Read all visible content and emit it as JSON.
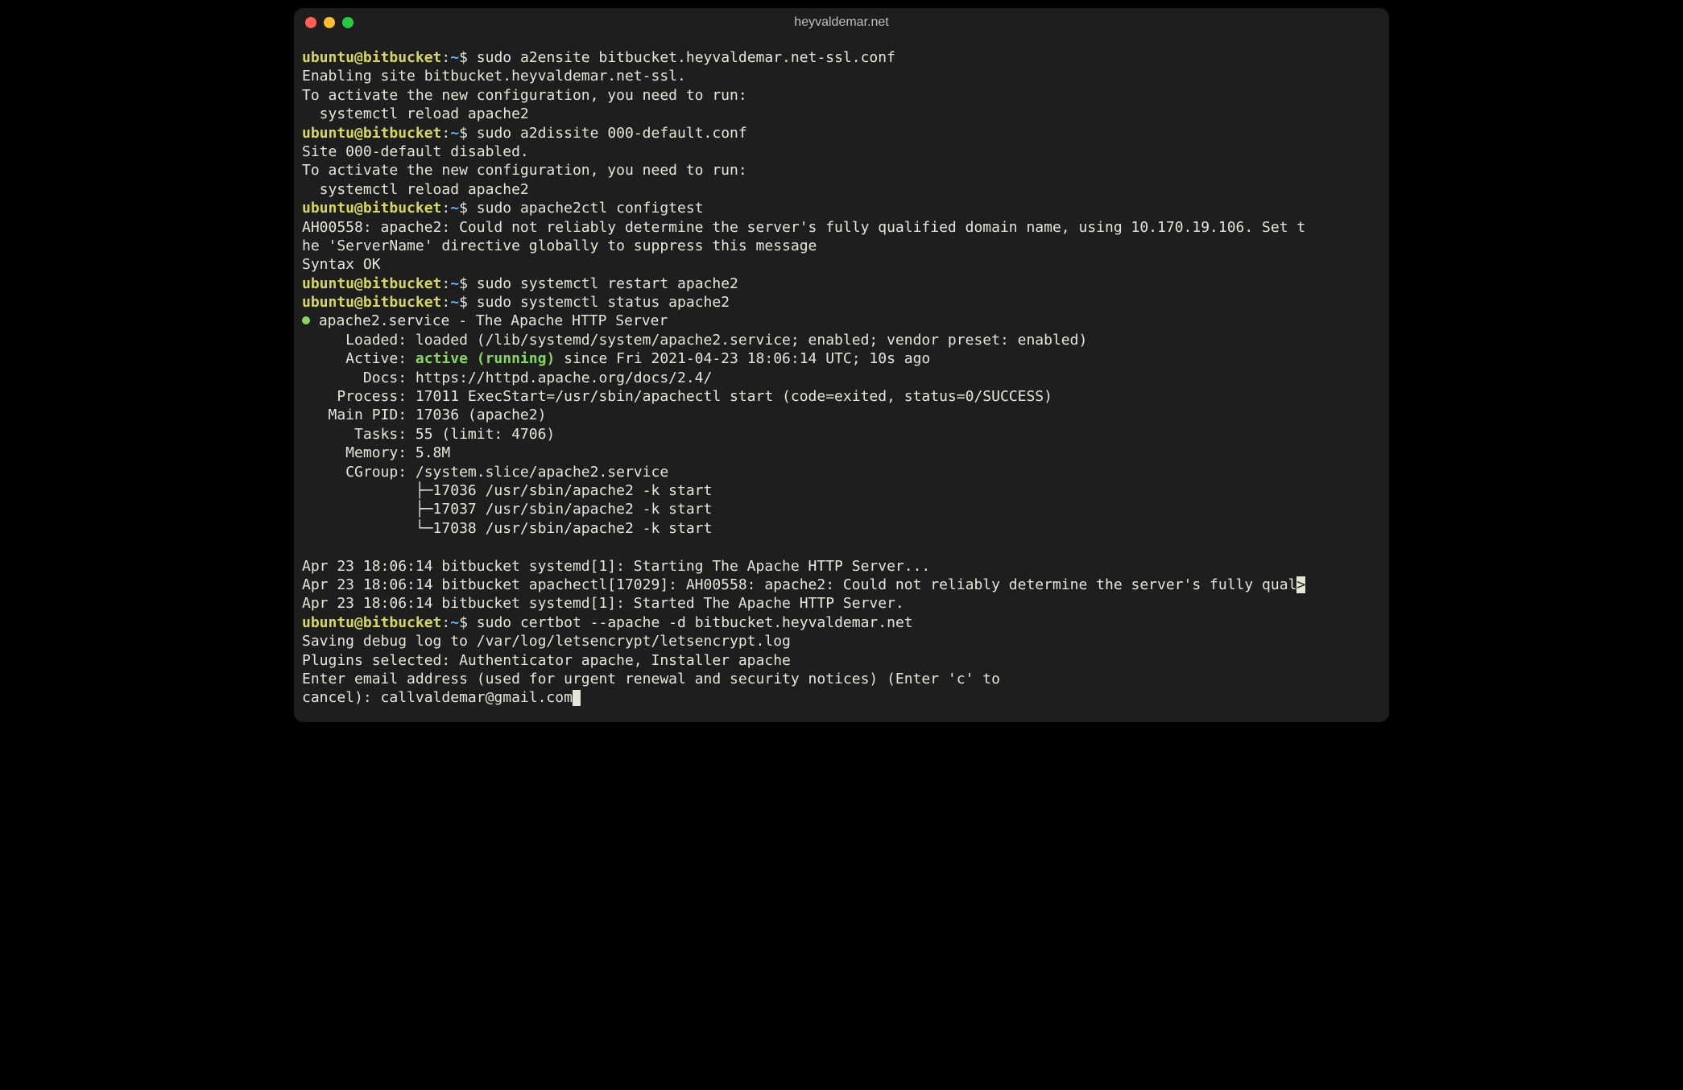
{
  "window": {
    "title": "heyvaldemar.net"
  },
  "prompt": {
    "user": "ubuntu@bitbucket",
    "sep": ":",
    "path": "~",
    "sigil": "$ "
  },
  "c1": {
    "cmd": "sudo a2ensite bitbucket.heyvaldemar.net-ssl.conf",
    "o1": "Enabling site bitbucket.heyvaldemar.net-ssl.",
    "o2": "To activate the new configuration, you need to run:",
    "o3": "  systemctl reload apache2"
  },
  "c2": {
    "cmd": "sudo a2dissite 000-default.conf",
    "o1": "Site 000-default disabled.",
    "o2": "To activate the new configuration, you need to run:",
    "o3": "  systemctl reload apache2"
  },
  "c3": {
    "cmd": "sudo apache2ctl configtest",
    "o1": "AH00558: apache2: Could not reliably determine the server's fully qualified domain name, using 10.170.19.106. Set t",
    "o2": "he 'ServerName' directive globally to suppress this message",
    "o3": "Syntax OK"
  },
  "c4": {
    "cmd": "sudo systemctl restart apache2"
  },
  "c5": {
    "cmd": "sudo systemctl status apache2",
    "o1a": " apache2.service - The Apache HTTP Server",
    "o2": "     Loaded: loaded (/lib/systemd/system/apache2.service; enabled; vendor preset: enabled)",
    "o3a": "     Active: ",
    "o3b": "active (running)",
    "o3c": " since Fri 2021-04-23 18:06:14 UTC; 10s ago",
    "o4": "       Docs: https://httpd.apache.org/docs/2.4/",
    "o5": "    Process: 17011 ExecStart=/usr/sbin/apachectl start (code=exited, status=0/SUCCESS)",
    "o6": "   Main PID: 17036 (apache2)",
    "o7": "      Tasks: 55 (limit: 4706)",
    "o8": "     Memory: 5.8M",
    "o9": "     CGroup: /system.slice/apache2.service",
    "o10": "             ├─17036 /usr/sbin/apache2 -k start",
    "o11": "             ├─17037 /usr/sbin/apache2 -k start",
    "o12": "             └─17038 /usr/sbin/apache2 -k start",
    "blank": "",
    "o13": "Apr 23 18:06:14 bitbucket systemd[1]: Starting The Apache HTTP Server...",
    "o14a": "Apr 23 18:06:14 bitbucket apachectl[17029]: AH00558: apache2: Could not reliably determine the server's fully qual",
    "o14b": ">",
    "o15": "Apr 23 18:06:14 bitbucket systemd[1]: Started The Apache HTTP Server."
  },
  "c6": {
    "cmd": "sudo certbot --apache -d bitbucket.heyvaldemar.net",
    "o1": "Saving debug log to /var/log/letsencrypt/letsencrypt.log",
    "o2": "Plugins selected: Authenticator apache, Installer apache",
    "o3": "Enter email address (used for urgent renewal and security notices) (Enter 'c' to",
    "o4": "cancel): callvaldemar@gmail.com"
  }
}
